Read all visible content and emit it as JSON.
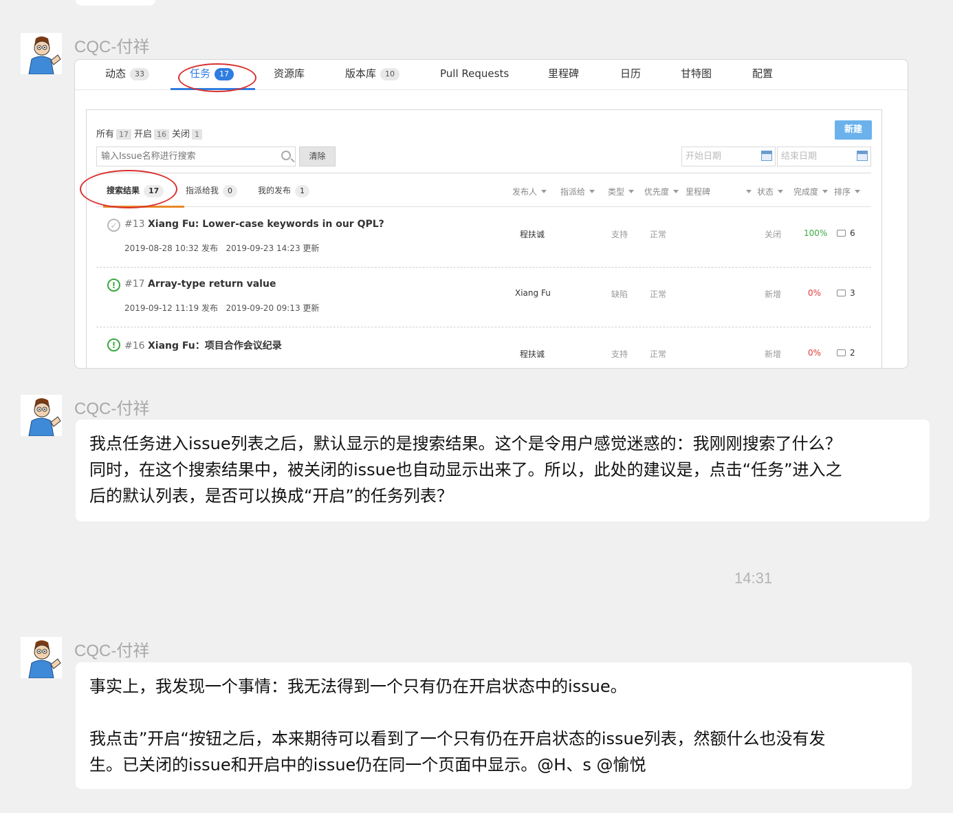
{
  "messages": [
    {
      "sender": "CQC-付祥",
      "type": "screenshot",
      "screenshot": {
        "tabs": [
          {
            "label": "动态",
            "count": "33"
          },
          {
            "label": "任务",
            "count": "17",
            "active": true
          },
          {
            "label": "资源库",
            "count": ""
          },
          {
            "label": "版本库",
            "count": "10"
          },
          {
            "label": "Pull Requests",
            "count": ""
          },
          {
            "label": "里程碑",
            "count": ""
          },
          {
            "label": "日历",
            "count": ""
          },
          {
            "label": "甘特图",
            "count": ""
          },
          {
            "label": "配置",
            "count": ""
          }
        ],
        "filter": {
          "all_label": "所有",
          "all_count": "17",
          "open_label": "开启",
          "open_count": "16",
          "closed_label": "关闭",
          "closed_count": "1"
        },
        "new_button": "新建",
        "search_placeholder": "输入Issue名称进行搜索",
        "clear_button": "清除",
        "start_date_placeholder": "开始日期",
        "end_date_placeholder": "结束日期",
        "subtabs": [
          {
            "label": "搜索结果",
            "count": "17",
            "active": true
          },
          {
            "label": "指派给我",
            "count": "0"
          },
          {
            "label": "我的发布",
            "count": "1"
          }
        ],
        "columns": [
          "发布人",
          "指派给",
          "类型",
          "优先度",
          "里程碑",
          "状态",
          "完成度",
          "排序"
        ],
        "issues": [
          {
            "number": "#13",
            "title": "Xiang Fu: Lower-case keywords in our QPL?",
            "status_icon": "closed",
            "created": "2019-08-28 10:32",
            "created_label": "发布",
            "updated": "2019-09-23 14:23",
            "updated_label": "更新",
            "author": "程扶诚",
            "type": "支持",
            "priority": "正常",
            "state": "关闭",
            "progress": "100%",
            "progress_color": "green",
            "comments": "6"
          },
          {
            "number": "#17",
            "title": "Array-type return value",
            "status_icon": "open",
            "created": "2019-09-12 11:19",
            "created_label": "发布",
            "updated": "2019-09-20 09:13",
            "updated_label": "更新",
            "author": "Xiang Fu",
            "type": "缺陷",
            "priority": "正常",
            "state": "新增",
            "progress": "0%",
            "progress_color": "red",
            "comments": "3"
          },
          {
            "number": "#16",
            "title": "Xiang Fu：项目合作会议纪录",
            "status_icon": "open",
            "created": "",
            "created_label": "",
            "updated": "",
            "updated_label": "",
            "author": "程扶诚",
            "type": "支持",
            "priority": "正常",
            "state": "新增",
            "progress": "0%",
            "progress_color": "red",
            "comments": "2"
          }
        ]
      }
    },
    {
      "sender": "CQC-付祥",
      "type": "text",
      "lines": [
        "我点任务进入issue列表之后，默认显示的是搜索结果。这个是令用户感觉迷惑的：我刚刚搜索了什么？",
        "同时，在这个搜索结果中，被关闭的issue也自动显示出来了。所以，此处的建议是，点击“任务”进入之",
        "后的默认列表，是否可以换成“开启”的任务列表？"
      ]
    },
    {
      "type": "timestamp",
      "text": "14:31"
    },
    {
      "sender": "CQC-付祥",
      "type": "text",
      "lines": [
        "事实上，我发现一个事情：我无法得到一个只有仍在开启状态中的issue。",
        "",
        "我点击”开启“按钮之后，本来期待可以看到了一个只有仍在开启状态的issue列表，然额什么也没有发",
        "生。已关闭的issue和开启中的issue仍在同一个页面中显示。@H、s @愉悦"
      ]
    }
  ],
  "colors": {
    "accent_blue": "#2e7de0",
    "annotation_red": "#d8302e",
    "subtab_orange": "#e88a28",
    "progress_green": "#3aa841",
    "progress_red": "#e03838"
  }
}
